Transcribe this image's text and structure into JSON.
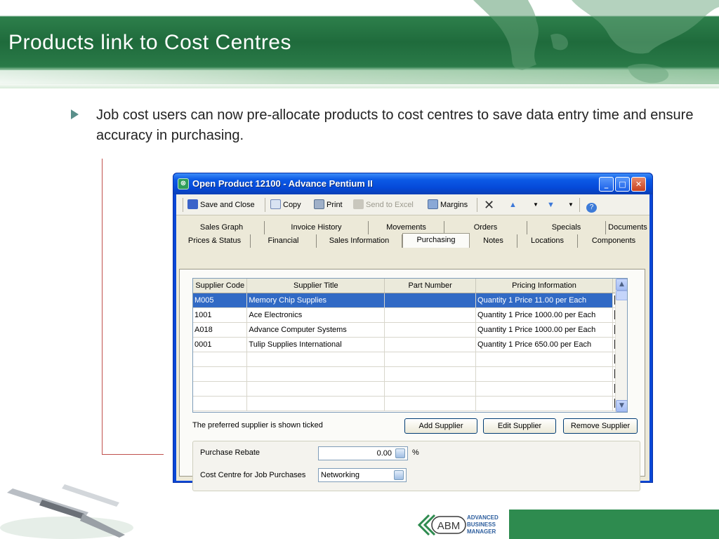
{
  "slide": {
    "title": "Products link to Cost Centres",
    "bullet": "Job cost users can now pre-allocate products to cost centres to save data entry time and ensure accuracy in purchasing."
  },
  "window": {
    "title": "Open Product 12100 - Advance Pentium II",
    "caption_buttons": [
      "minimize",
      "maximize",
      "close"
    ]
  },
  "toolbar": {
    "save_close": "Save and Close",
    "copy": "Copy",
    "print": "Print",
    "send_excel": "Send to Excel",
    "margins": "Margins"
  },
  "tabs": {
    "row1": [
      "Sales Graph",
      "Invoice History",
      "Movements",
      "Orders",
      "Specials",
      "Documents"
    ],
    "row2": [
      "Prices & Status",
      "Financial",
      "Sales Information",
      "Purchasing",
      "Notes",
      "Locations",
      "Components"
    ],
    "active": "Purchasing"
  },
  "grid": {
    "headers": [
      "Supplier Code",
      "Supplier Title",
      "Part Number",
      "Pricing Information"
    ],
    "rows": [
      {
        "code": "M005",
        "title": "Memory Chip Supplies",
        "part": "",
        "pricing": "Quantity 1 Price 11.00 per Each",
        "preferred": true
      },
      {
        "code": "1001",
        "title": "Ace Electronics",
        "part": "",
        "pricing": "Quantity 1 Price 1000.00 per Each",
        "preferred": false
      },
      {
        "code": "A018",
        "title": "Advance Computer Systems",
        "part": "",
        "pricing": "Quantity 1 Price 1000.00 per Each",
        "preferred": false
      },
      {
        "code": "0001",
        "title": "Tulip Supplies International",
        "part": "",
        "pricing": "Quantity 1 Price 650.00 per Each",
        "preferred": false
      }
    ]
  },
  "purchasing": {
    "preferred_note": "The preferred supplier is shown ticked",
    "add_supplier": "Add Supplier",
    "edit_supplier": "Edit Supplier",
    "remove_supplier": "Remove Supplier",
    "rebate_label": "Purchase Rebate",
    "rebate_value": "0.00",
    "rebate_unit": "%",
    "cost_centre_label": "Cost Centre for Job Purchases",
    "cost_centre_value": "Networking"
  },
  "brand": {
    "logo": "ABM",
    "line1": "ADVANCED",
    "line2": "BUSINESS",
    "line3": "MANAGER",
    "green": "#2e8b4f",
    "title_bar_blue": "#0549d8",
    "selection_blue": "#316ac5"
  }
}
